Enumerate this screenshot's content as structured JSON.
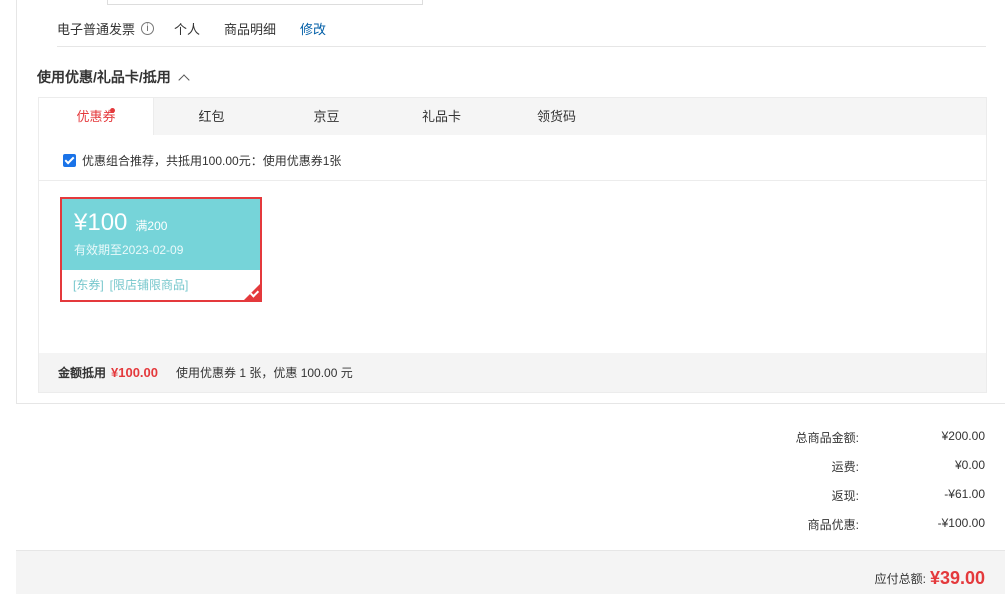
{
  "invoice": {
    "type": "电子普通发票",
    "info_icon": "i",
    "title": "个人",
    "content": "商品明细",
    "edit": "修改"
  },
  "discount_section": {
    "title": "使用优惠/礼品卡/抵用",
    "tabs": [
      {
        "label": "优惠券"
      },
      {
        "label": "红包"
      },
      {
        "label": "京豆"
      },
      {
        "label": "礼品卡"
      },
      {
        "label": "领货码"
      }
    ],
    "summary": "优惠组合推荐，共抵用100.00元：使用优惠券1张",
    "coupon": {
      "amount": "¥100",
      "threshold": "满200",
      "expiry": "有效期至2023-02-09",
      "tag1": "[东券]",
      "tag2": "[限店铺限商品]"
    },
    "footer": {
      "label": "金额抵用",
      "amount": "¥100.00",
      "detail": "使用优惠券 1 张，优惠 100.00 元"
    }
  },
  "totals": {
    "goods_label": "总商品金额:",
    "goods_value": "¥200.00",
    "shipping_label": "运费:",
    "shipping_value": "¥0.00",
    "cashback_label": "返现:",
    "cashback_value": "-¥61.00",
    "discount_label": "商品优惠:",
    "discount_value": "-¥100.00",
    "payable_label": "应付总额:",
    "payable_value": "¥39.00"
  },
  "colors": {
    "accent_red": "#e4393c",
    "coupon_teal": "#76d4d9",
    "link_blue": "#005ea7"
  }
}
